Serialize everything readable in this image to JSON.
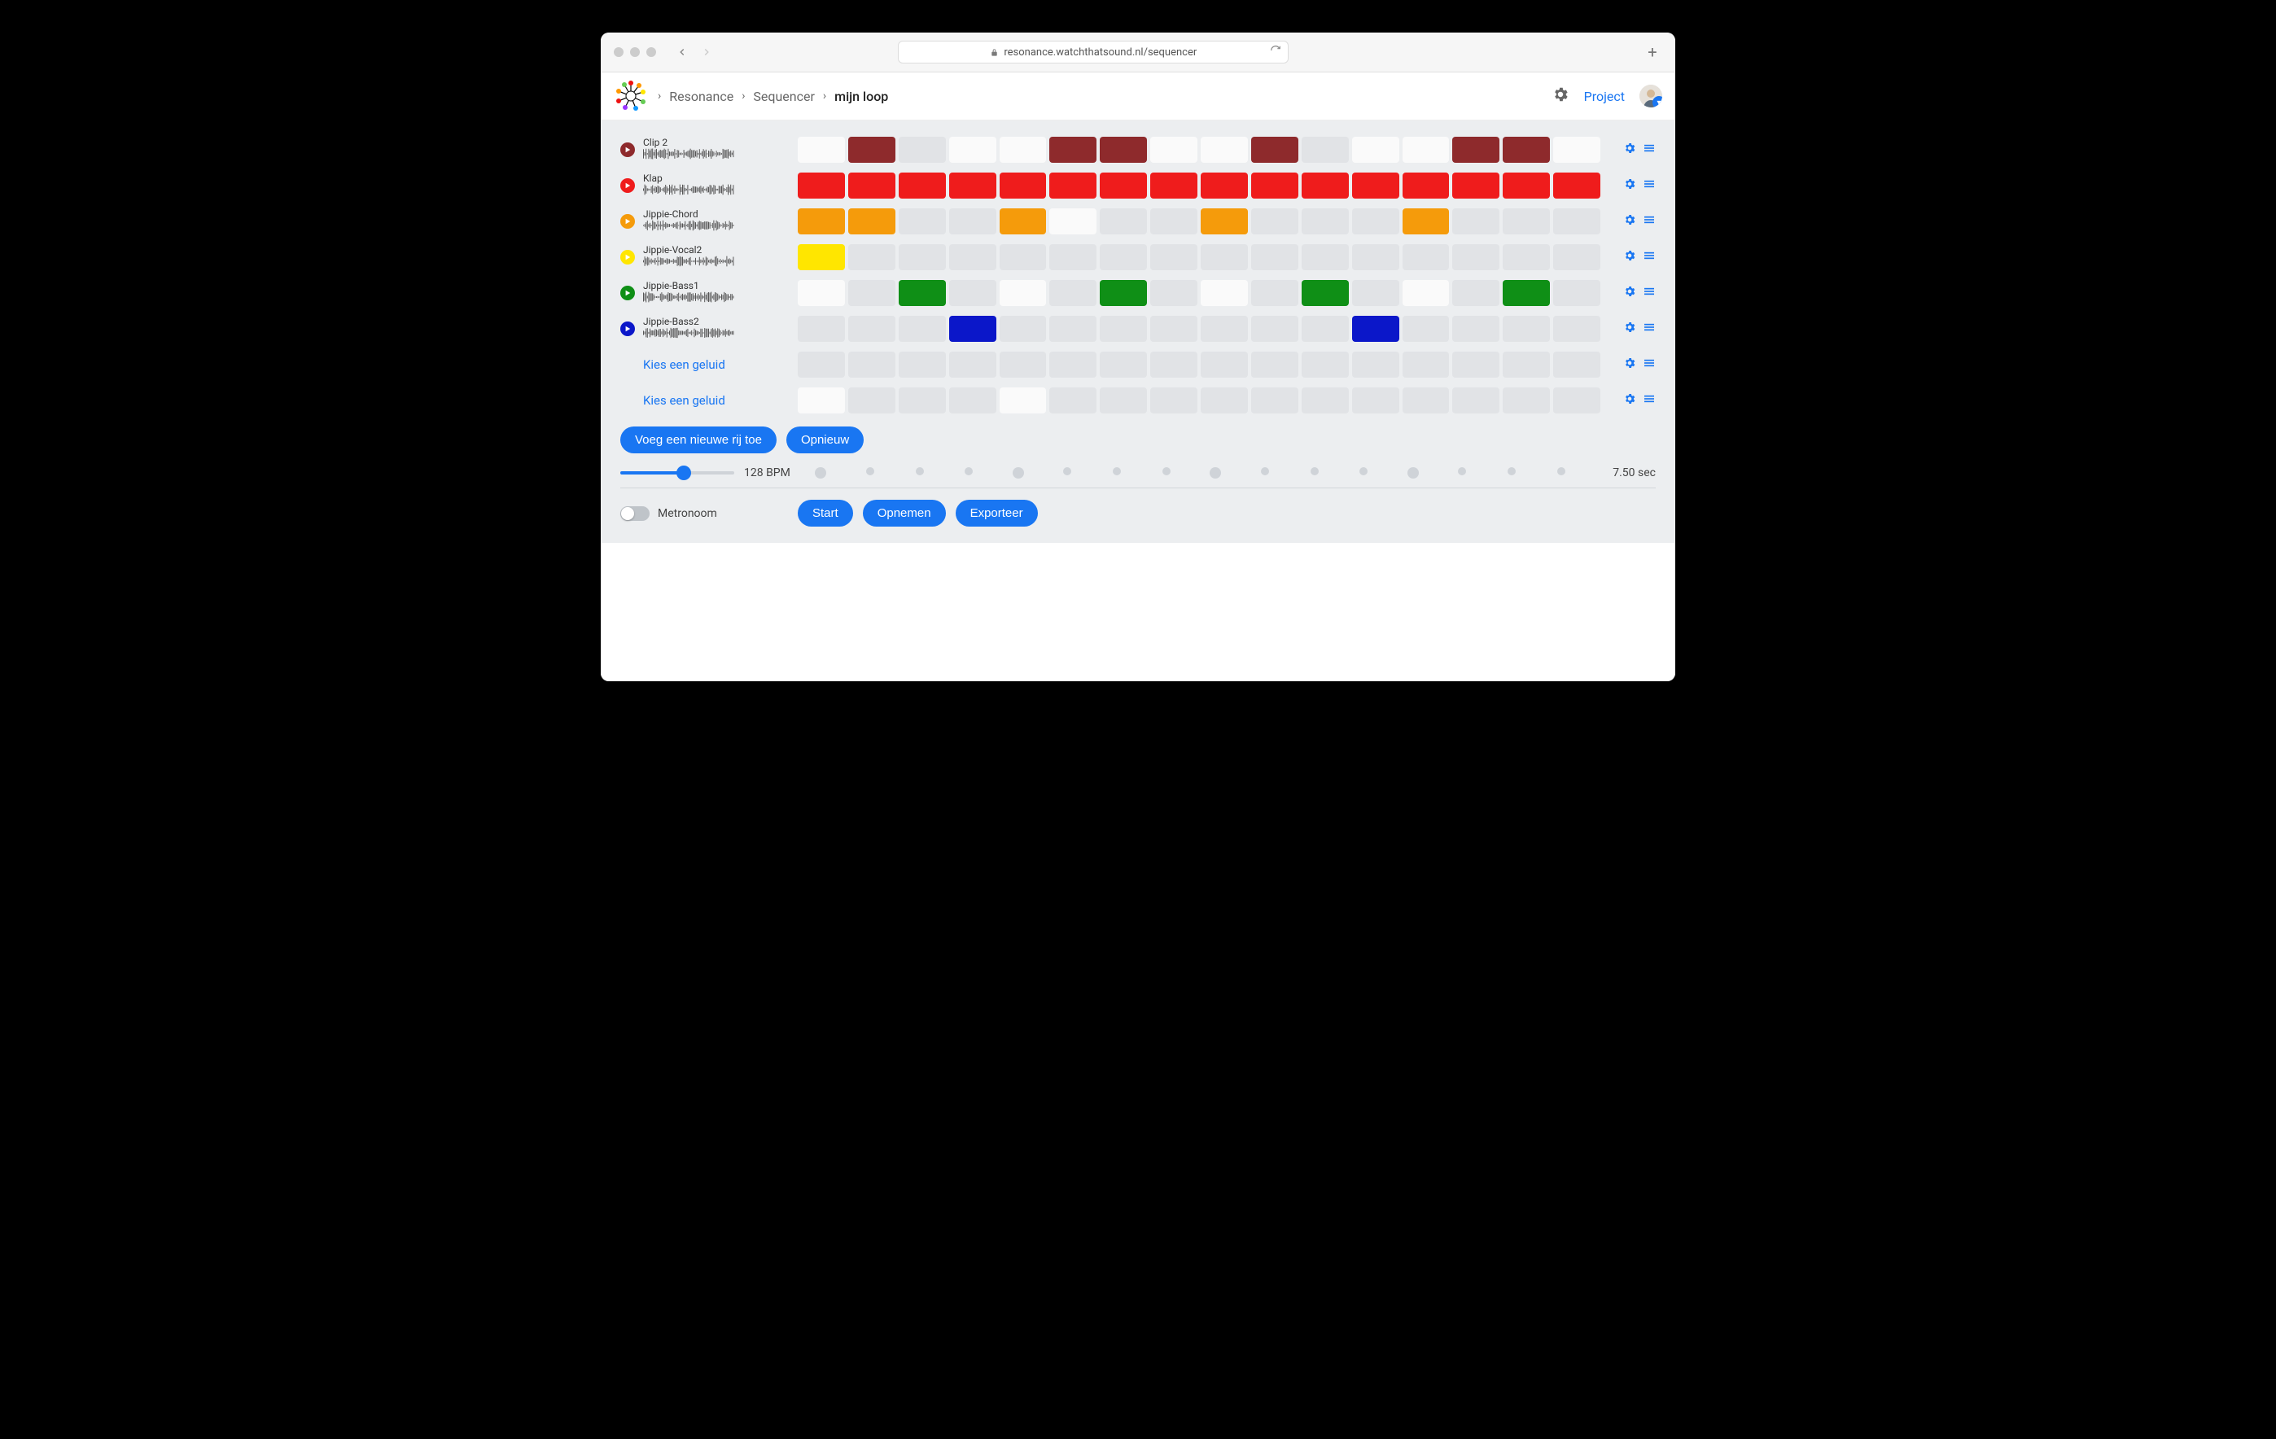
{
  "browser": {
    "url": "resonance.watchthatsound.nl/sequencer"
  },
  "header": {
    "breadcrumbs": [
      "Resonance",
      "Sequencer",
      "mijn loop"
    ],
    "project_link": "Project"
  },
  "sequencer": {
    "steps": 16,
    "tracks": [
      {
        "name": "Clip 2",
        "color": "#8e2a2c",
        "color_class": "c-darkred",
        "pattern": [
          0,
          1,
          0,
          0,
          0,
          1,
          1,
          0,
          0,
          1,
          0,
          0,
          0,
          1,
          1,
          0
        ],
        "off_whites": [
          0,
          3,
          4,
          7,
          8,
          11,
          12,
          15
        ]
      },
      {
        "name": "Klap",
        "color": "#ef1c1c",
        "color_class": "c-red",
        "pattern": [
          1,
          1,
          1,
          1,
          1,
          1,
          1,
          1,
          1,
          1,
          1,
          1,
          1,
          1,
          1,
          1
        ],
        "off_whites": []
      },
      {
        "name": "Jippie-Chord",
        "color": "#f59b0b",
        "color_class": "c-orange",
        "pattern": [
          1,
          1,
          0,
          0,
          1,
          0,
          0,
          0,
          1,
          0,
          0,
          0,
          1,
          0,
          0,
          0
        ],
        "off_whites": [
          5
        ]
      },
      {
        "name": "Jippie-Vocal2",
        "color": "#ffe600",
        "color_class": "c-yellow",
        "pattern": [
          1,
          0,
          0,
          0,
          0,
          0,
          0,
          0,
          0,
          0,
          0,
          0,
          0,
          0,
          0,
          0
        ],
        "off_whites": []
      },
      {
        "name": "Jippie-Bass1",
        "color": "#0f8f16",
        "color_class": "c-green",
        "pattern": [
          0,
          0,
          1,
          0,
          0,
          0,
          1,
          0,
          0,
          0,
          1,
          0,
          0,
          0,
          1,
          0
        ],
        "off_whites": [
          0,
          4,
          8,
          12
        ]
      },
      {
        "name": "Jippie-Bass2",
        "color": "#0b17c9",
        "color_class": "c-blue",
        "pattern": [
          0,
          0,
          0,
          1,
          0,
          0,
          0,
          0,
          0,
          0,
          0,
          1,
          0,
          0,
          0,
          0
        ],
        "off_whites": []
      },
      {
        "name": null,
        "choose_label": "Kies een geluid",
        "pattern": [
          0,
          0,
          0,
          0,
          0,
          0,
          0,
          0,
          0,
          0,
          0,
          0,
          0,
          0,
          0,
          0
        ],
        "off_whites": []
      },
      {
        "name": null,
        "choose_label": "Kies een geluid",
        "pattern": [
          0,
          0,
          0,
          0,
          0,
          0,
          0,
          0,
          0,
          0,
          0,
          0,
          0,
          0,
          0,
          0
        ],
        "off_whites": [
          0,
          4
        ]
      }
    ],
    "buttons": {
      "add_row": "Voeg een nieuwe rij toe",
      "reset": "Opnieuw",
      "start": "Start",
      "record": "Opnemen",
      "export": "Exporteer"
    },
    "bpm_value": 128,
    "bpm_label": "128 BPM",
    "duration_label": "7.50 sec",
    "metronome_label": "Metronoom",
    "beat_accents": [
      0,
      4,
      8,
      12
    ]
  }
}
